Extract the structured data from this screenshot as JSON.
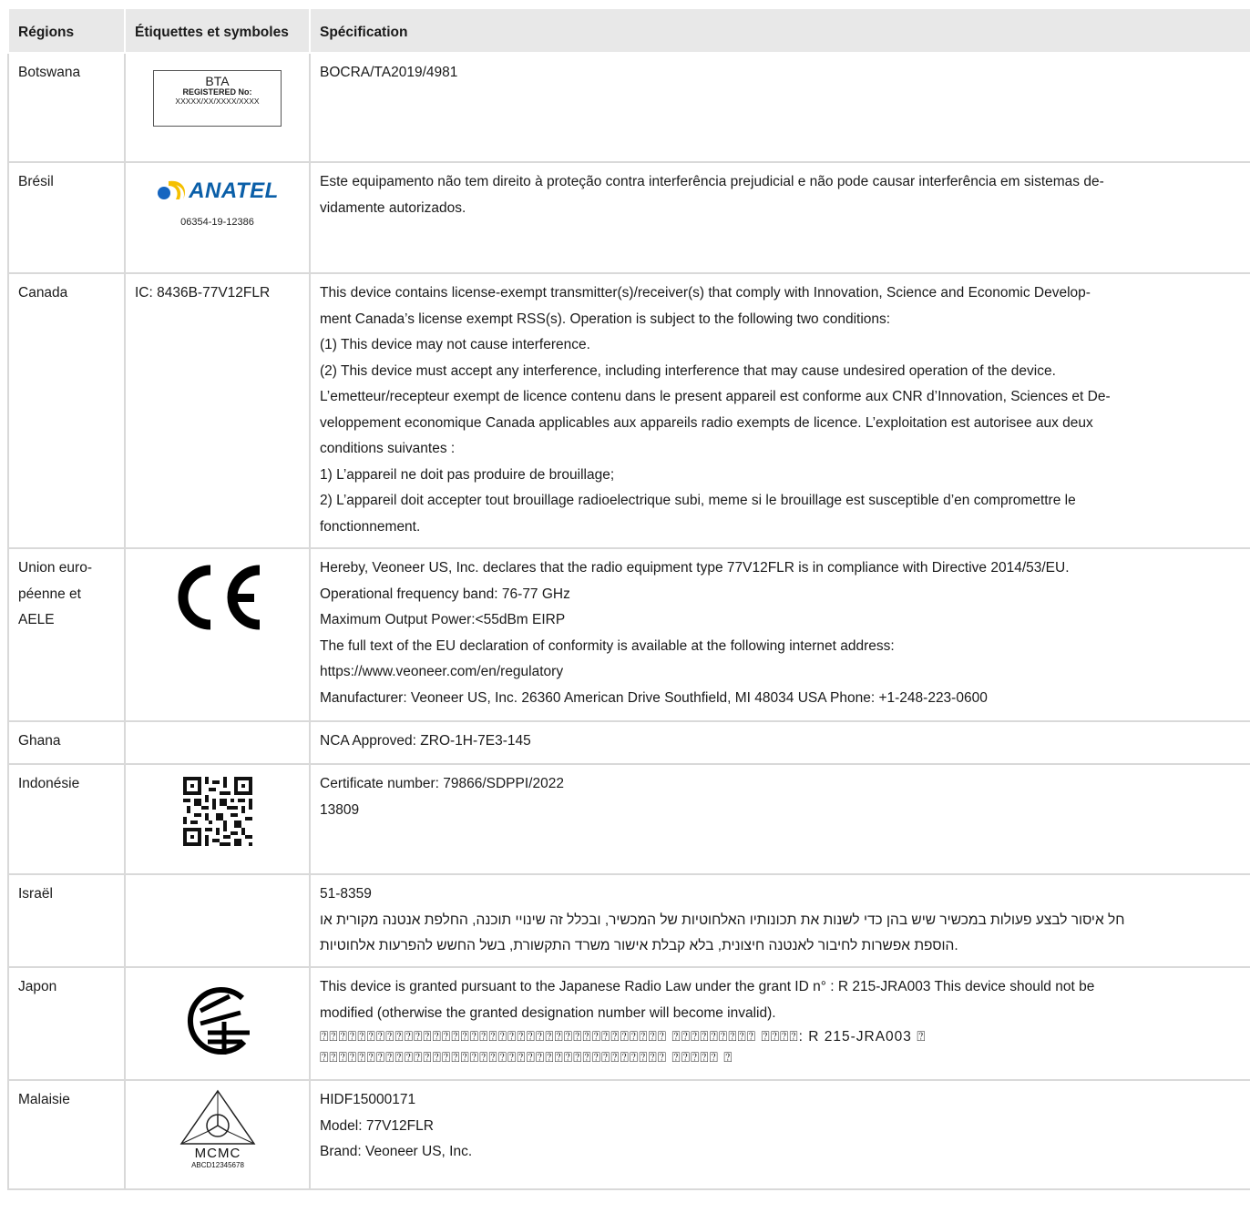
{
  "headers": {
    "region": "Régions",
    "labels": "Étiquettes et symboles",
    "spec": "Spécification"
  },
  "rows": {
    "botswana": {
      "region": "Botswana",
      "badge": {
        "line1": "BTA",
        "line2": "REGISTERED No:",
        "line3": "XXXXX/XX/XXXX/XXXX"
      },
      "spec": [
        "BOCRA/TA2019/4981"
      ]
    },
    "brazil": {
      "region": "Brésil",
      "logo_text": "ANATEL",
      "logo_number": "06354-19-12386",
      "spec": [
        "Este equipamento não tem direito à proteção contra interferência prejudicial e não pode causar interferência em sistemas de-",
        "vidamente autorizados."
      ]
    },
    "canada": {
      "region": "Canada",
      "label": "IC: 8436B-77V12FLR",
      "spec": [
        "This device contains license-exempt transmitter(s)/receiver(s) that comply with Innovation, Science and Economic Develop-",
        "ment Canada’s license exempt RSS(s). Operation is subject to the following two conditions:",
        "(1) This device may not cause interference.",
        "(2) This device must accept any interference, including interference that may cause undesired operation of the device.",
        "L’emetteur/recepteur exempt de licence contenu dans le present appareil est conforme aux CNR d’Innovation, Sciences et De-",
        "veloppement economique Canada applicables aux appareils radio exempts de licence. L’exploitation est autorisee aux deux",
        "conditions suivantes :",
        "1) L’appareil ne doit pas produire de brouillage;",
        "2) L’appareil doit accepter tout brouillage radioelectrique subi, meme si le brouillage est susceptible d’en compromettre le",
        "fonctionnement."
      ]
    },
    "eu": {
      "region_lines": [
        "Union euro-",
        "péenne et",
        "AELE"
      ],
      "spec": [
        "Hereby, Veoneer US, Inc. declares that the radio equipment type 77V12FLR is in compliance with Directive 2014/53/EU.",
        "Operational frequency band: 76-77 GHz",
        "Maximum Output Power:<55dBm EIRP",
        "The full text of the EU declaration of conformity is available at the following internet address:",
        "https://www.veoneer.com/en/regulatory",
        "Manufacturer: Veoneer US, Inc. 26360 American Drive Southfield, MI 48034 USA Phone: +1-248-223-0600"
      ]
    },
    "ghana": {
      "region": "Ghana",
      "spec": [
        "NCA Approved: ZRO-1H-7E3-145"
      ]
    },
    "indonesia": {
      "region": "Indonésie",
      "spec": [
        "Certificate number: 79866/SDPPI/2022",
        "13809"
      ]
    },
    "israel": {
      "region": "Israël",
      "spec": [
        "51-8359",
        "חל איסור לבצע פעולות במכשיר שיש בהן כדי לשנות את תכונותיו האלחוטיות של המכשיר, ובכלל זה שינויי תוכנה, החלפת אנטנה מקורית או",
        ".הוספת אפשרות לחיבור לאנטנה חיצונית, בלא קבלת אישור משרד התקשורת, בשל החשש להפרעות אלחוטיות"
      ]
    },
    "japan": {
      "region": "Japon",
      "spec": [
        "This device is granted pursuant to the Japanese Radio Law under the grant ID n° : R 215-JRA003 This device should not be",
        "modified (otherwise the granted designation number will become invalid).",
        "⍰⍰⍰⍰⍰⍰⍰⍰⍰⍰⍰⍰⍰⍰⍰⍰⍰⍰⍰⍰⍰⍰⍰⍰⍰⍰⍰⍰⍰⍰⍰⍰⍰⍰⍰⍰⍰ ⍰⍰⍰⍰⍰⍰⍰⍰⍰ ⍰⍰⍰⍰: R 215-JRA003 ⍰",
        "⍰⍰⍰⍰⍰⍰⍰⍰⍰⍰⍰⍰⍰⍰⍰⍰⍰⍰⍰⍰⍰⍰⍰⍰⍰⍰⍰⍰⍰⍰⍰⍰⍰⍰⍰⍰⍰ ⍰⍰⍰⍰⍰ ⍰"
      ]
    },
    "malaysia": {
      "region": "Malaisie",
      "badge": {
        "line1": "MCMC",
        "line2": "ABCD12345678"
      },
      "spec": [
        "HIDF15000171",
        "Model: 77V12FLR",
        "Brand: Veoneer US, Inc."
      ]
    }
  }
}
